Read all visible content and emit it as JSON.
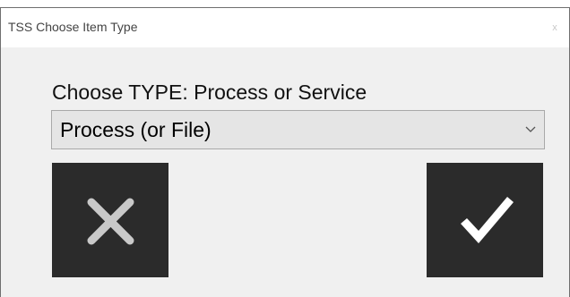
{
  "window": {
    "title": "TSS Choose Item Type",
    "close_glyph": "x"
  },
  "prompt": {
    "label": "Choose TYPE:  Process or Service"
  },
  "type_select": {
    "selected": "Process (or File)"
  },
  "buttons": {
    "cancel_icon": "x-cross-icon",
    "ok_icon": "checkmark-icon"
  },
  "colors": {
    "button_bg": "#2b2b2b",
    "cross_color": "#c9c9c9",
    "check_color": "#ffffff",
    "dialog_bg": "#f0f0f0",
    "select_bg": "#e5e5e5"
  }
}
